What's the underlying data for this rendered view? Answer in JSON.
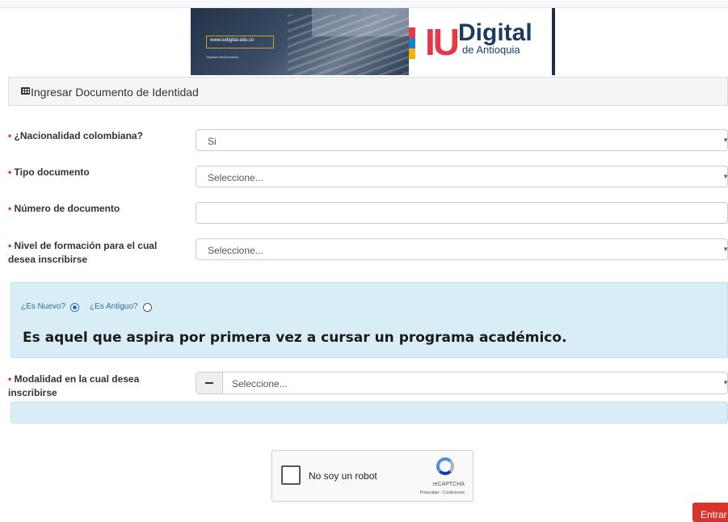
{
  "banner": {
    "url_text": "www.iudigital.edu.co",
    "vigilada_text": "Vigilada MinEducación",
    "logo_iu": "IU",
    "logo_digital": "Digital",
    "logo_sub": "de Antioquia"
  },
  "panel": {
    "title": "Ingresar Documento de Identidad",
    "icon": "table-icon"
  },
  "form": {
    "required_mark": "•",
    "nacionalidad": {
      "label": "¿Nacionalidad colombiana?",
      "value": "Si"
    },
    "tipo_documento": {
      "label": "Tipo documento",
      "value": "Seleccione..."
    },
    "numero_documento": {
      "label": "Número de documento",
      "value": ""
    },
    "nivel_formacion": {
      "label_line1": "Nivel de formación para el cual",
      "label_line2": "desea inscribirse",
      "value": "Seleccione..."
    },
    "aspirante": {
      "nuevo_label": "¿Es Nuevo?",
      "antiguo_label": "¿Es Antiguo?",
      "selected": "nuevo",
      "description": "Es aquel que aspira por primera vez a cursar un programa académico."
    },
    "modalidad": {
      "label_line1": "Modalidad en la cual desea",
      "label_line2": "inscribirse",
      "value": "Seleccione..."
    }
  },
  "captcha": {
    "label": "No soy un robot",
    "brand": "reCAPTCHA",
    "terms": "Privacidad - Condiciones"
  },
  "submit": {
    "label": "Entrar"
  },
  "colors": {
    "required": "#e0302f",
    "info_bg": "#d9edf7",
    "button": "#d9342b"
  }
}
